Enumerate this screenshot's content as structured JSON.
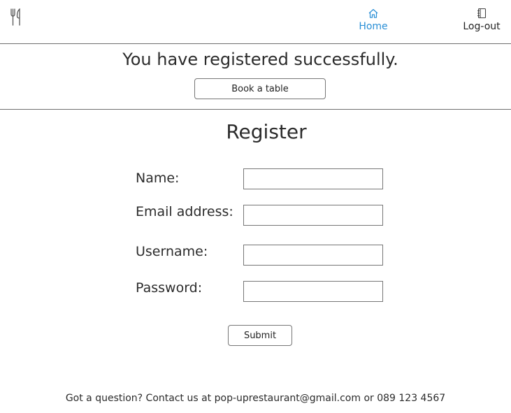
{
  "header": {
    "logo_icon": "fork-knife-icon",
    "nav": [
      {
        "label": "Home",
        "icon": "home-icon",
        "active": true
      },
      {
        "label": "Log-out",
        "icon": "journal-icon",
        "active": false
      }
    ]
  },
  "banner": {
    "message": "You have registered successfully.",
    "book_label": "Book a table"
  },
  "form": {
    "title": "Register",
    "fields": [
      {
        "label": "Name:",
        "value": ""
      },
      {
        "label": "Email address:",
        "value": ""
      },
      {
        "label": "Username:",
        "value": ""
      },
      {
        "label": "Password:",
        "value": ""
      }
    ],
    "submit_label": "Submit"
  },
  "footer": {
    "text": "Got a question? Contact us at pop-uprestaurant@gmail.com or 089 123 4567"
  },
  "colors": {
    "accent": "#2a8fd6",
    "text": "#222222",
    "border": "#767676"
  }
}
